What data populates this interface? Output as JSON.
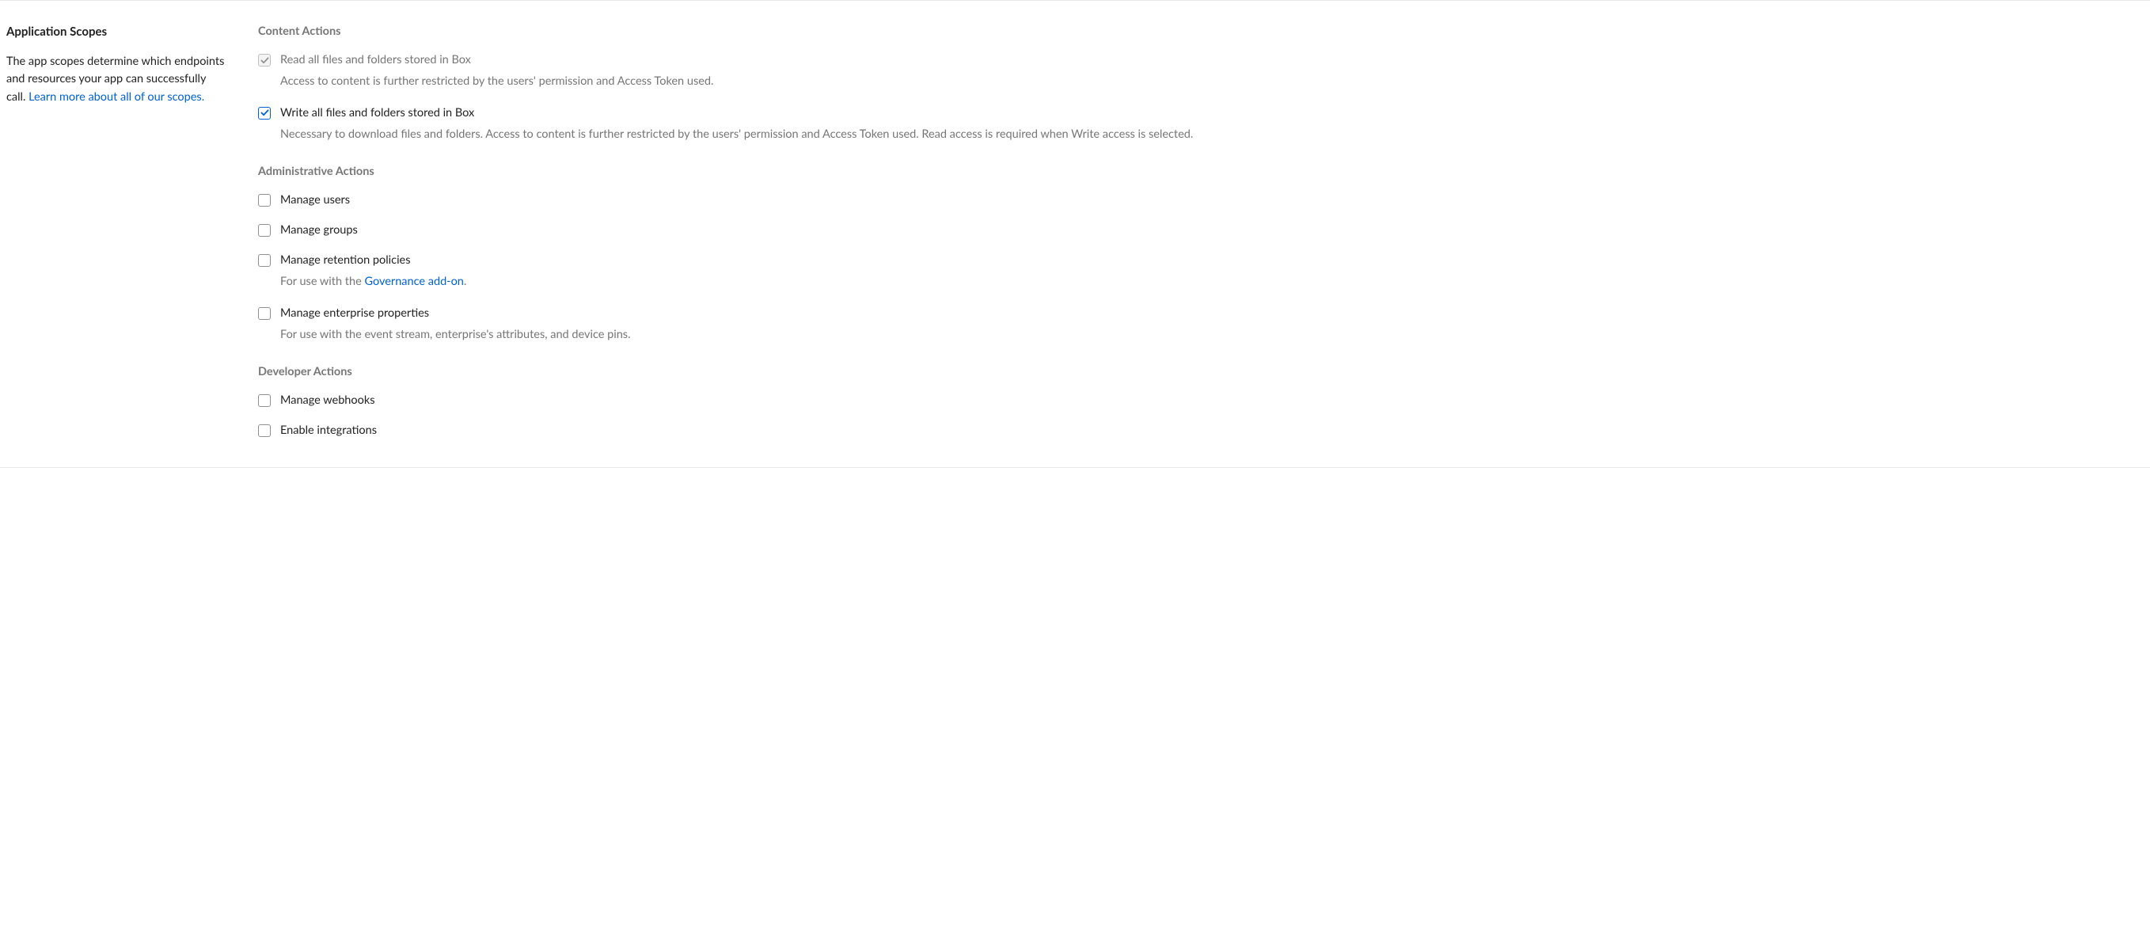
{
  "sidebar": {
    "title": "Application Scopes",
    "desc_part1": "The app scopes determine which endpoints and resources your app can successfully call. ",
    "link_text": "Learn more about all of our scopes."
  },
  "sections": {
    "content": {
      "title": "Content Actions",
      "items": {
        "read": {
          "label": "Read all files and folders stored in Box",
          "desc": "Access to content is further restricted by the users' permission and Access Token used."
        },
        "write": {
          "label": "Write all files and folders stored in Box",
          "desc": "Necessary to download files and folders. Access to content is further restricted by the users' permission and Access Token used. Read access is required when Write access is selected."
        }
      }
    },
    "admin": {
      "title": "Administrative Actions",
      "items": {
        "users": {
          "label": "Manage users"
        },
        "groups": {
          "label": "Manage groups"
        },
        "retention": {
          "label": "Manage retention policies",
          "desc_prefix": "For use with the ",
          "desc_link": "Governance add-on",
          "desc_suffix": "."
        },
        "enterprise": {
          "label": "Manage enterprise properties",
          "desc": "For use with the event stream, enterprise's attributes, and device pins."
        }
      }
    },
    "developer": {
      "title": "Developer Actions",
      "items": {
        "webhooks": {
          "label": "Manage webhooks"
        },
        "integrations": {
          "label": "Enable integrations"
        }
      }
    }
  }
}
